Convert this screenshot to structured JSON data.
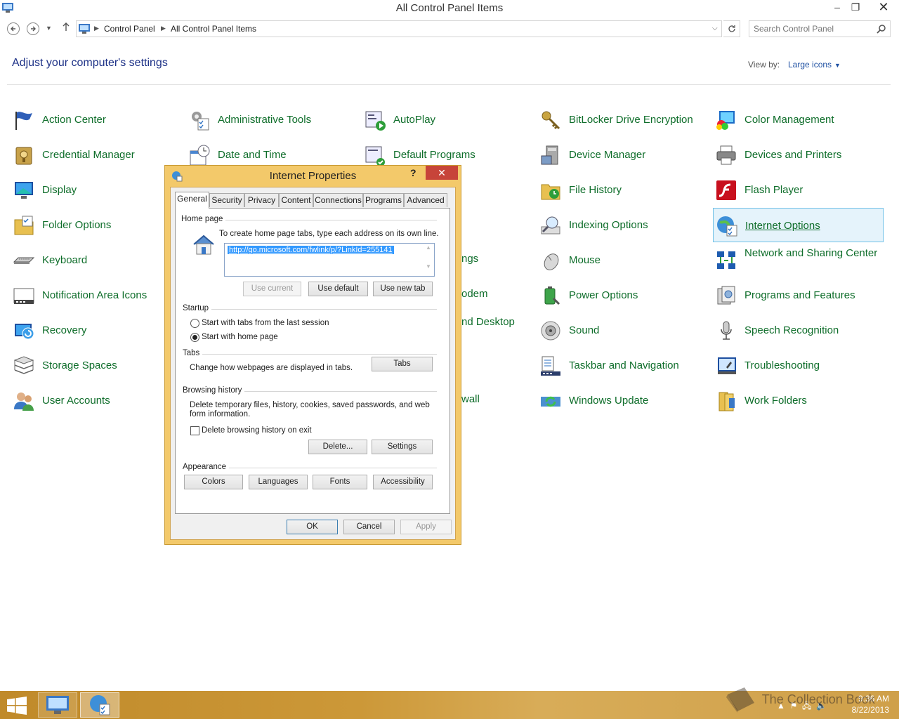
{
  "window": {
    "title": "All Control Panel Items",
    "minimize": "–",
    "maximize": "❐",
    "close": "✕"
  },
  "navbar": {
    "crumbs": [
      "Control Panel",
      "All Control Panel Items"
    ],
    "search_placeholder": "Search Control Panel"
  },
  "header": {
    "title": "Adjust your computer's settings",
    "view_by_label": "View by:",
    "view_by_value": "Large icons"
  },
  "items": [
    "Action Center",
    "Administrative Tools",
    "AutoPlay",
    "BitLocker Drive Encryption",
    "Color Management",
    "Credential Manager",
    "Date and Time",
    "Default Programs",
    "Device Manager",
    "Devices and Printers",
    "Display",
    "File History",
    "Flash Player",
    "Folder Options",
    "Indexing Options",
    "Internet Options",
    "Keyboard",
    "ngs",
    "Mouse",
    "Network and Sharing Center",
    "Notification Area Icons",
    "odem",
    "Power Options",
    "Programs and Features",
    "Recovery",
    "nd Desktop",
    "Sound",
    "Speech Recognition",
    "Storage Spaces",
    "Taskbar and Navigation",
    "Troubleshooting",
    "User Accounts",
    "wall",
    "Windows Update",
    "Work Folders"
  ],
  "dialog": {
    "title": "Internet Properties",
    "help": "?",
    "close": "✕",
    "tabs": [
      "General",
      "Security",
      "Privacy",
      "Content",
      "Connections",
      "Programs",
      "Advanced"
    ],
    "home_page": {
      "group": "Home page",
      "instructions": "To create home page tabs, type each address on its own line.",
      "url": "http://go.microsoft.com/fwlink/p/?LinkId=255141",
      "use_current": "Use current",
      "use_default": "Use default",
      "use_new_tab": "Use new tab"
    },
    "startup": {
      "group": "Startup",
      "option1": "Start with tabs from the last session",
      "option2": "Start with home page",
      "selected": "Start with home page"
    },
    "tabs_group": {
      "group": "Tabs",
      "text": "Change how webpages are displayed in tabs.",
      "button": "Tabs"
    },
    "browsing_history": {
      "group": "Browsing history",
      "text": "Delete temporary files, history, cookies, saved passwords, and web form information.",
      "checkbox": "Delete browsing history on exit",
      "delete": "Delete...",
      "settings": "Settings"
    },
    "appearance": {
      "group": "Appearance",
      "colors": "Colors",
      "languages": "Languages",
      "fonts": "Fonts",
      "accessibility": "Accessibility"
    },
    "ok": "OK",
    "cancel": "Cancel",
    "apply": "Apply"
  },
  "taskbar": {
    "watermark": "The Collection Book",
    "time": "9:36 AM",
    "date": "8/22/2013"
  }
}
